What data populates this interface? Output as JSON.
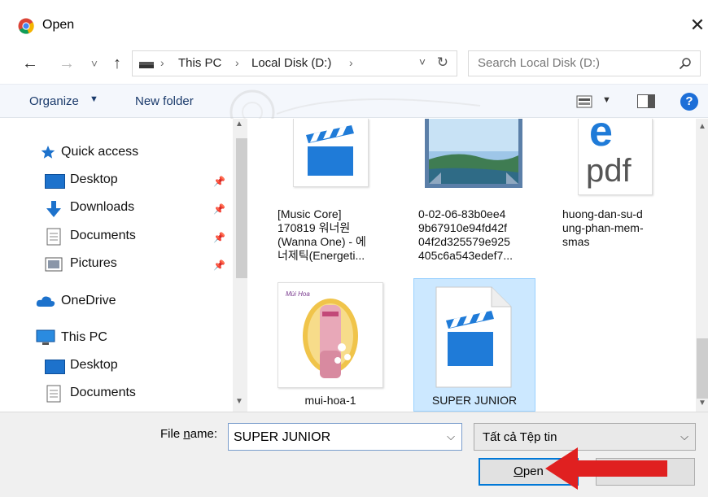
{
  "window": {
    "title": "Open",
    "close_glyph": "✕"
  },
  "nav_buttons": {
    "back": "←",
    "forward": "→",
    "recent": "˅",
    "up": "↑"
  },
  "address": {
    "crumbs": [
      "This PC",
      "Local Disk (D:)"
    ],
    "separator": "›",
    "dropdown": "˅",
    "refresh": "↻"
  },
  "search": {
    "placeholder": "Search Local Disk (D:)"
  },
  "toolbar": {
    "organize": "Organize",
    "organize_caret": "▼",
    "new_folder": "New folder",
    "view_caret": "▼",
    "help": "?"
  },
  "nav": {
    "items": [
      {
        "label": "Quick access",
        "icon": "star-icon"
      },
      {
        "label": "Desktop",
        "icon": "desktop-folder-icon",
        "pinned": true
      },
      {
        "label": "Downloads",
        "icon": "download-arrow-icon",
        "pinned": true
      },
      {
        "label": "Documents",
        "icon": "documents-icon",
        "pinned": true
      },
      {
        "label": "Pictures",
        "icon": "pictures-icon",
        "pinned": true
      },
      {
        "label": "OneDrive",
        "icon": "cloud-icon"
      },
      {
        "label": "This PC",
        "icon": "computer-icon"
      },
      {
        "label": "Desktop",
        "icon": "desktop-folder-icon"
      },
      {
        "label": "Documents",
        "icon": "documents-icon"
      }
    ],
    "pin_glyph": "📌"
  },
  "files": [
    {
      "name_lines": [
        "[Music Core]",
        "170819 워너원",
        "(Wanna One) - 에",
        "너제틱(Energeti..."
      ],
      "icon": "video-clapper-icon"
    },
    {
      "name_lines": [
        "0-02-06-83b0ee4",
        "9b67910e94fd42f",
        "04f2d325579e925",
        "405c6a543edef7..."
      ],
      "icon": "image-thumbnail-icon"
    },
    {
      "name_lines": [
        "huong-dan-su-d",
        "ung-phan-mem-",
        "smas"
      ],
      "icon": "pdf-edge-icon",
      "icon_text": "pdf"
    },
    {
      "name_lines": [
        "mui-hoa-1"
      ],
      "icon": "product-photo-icon",
      "thumb_text": "Mùi Hoa"
    },
    {
      "name_lines": [
        "SUPER JUNIOR"
      ],
      "icon": "video-clapper-icon",
      "selected": true
    }
  ],
  "bottom": {
    "file_name_label": "File name:",
    "file_name_value": "SUPER JUNIOR",
    "file_type_value": "Tất cả Tệp tin",
    "dropdown": "⌵",
    "open_label": "Open",
    "cancel_label": ""
  },
  "colors": {
    "accent": "#0078d7",
    "selection": "#cce8ff",
    "clapper": "#1f7bd8",
    "arrow": "#e02020"
  }
}
